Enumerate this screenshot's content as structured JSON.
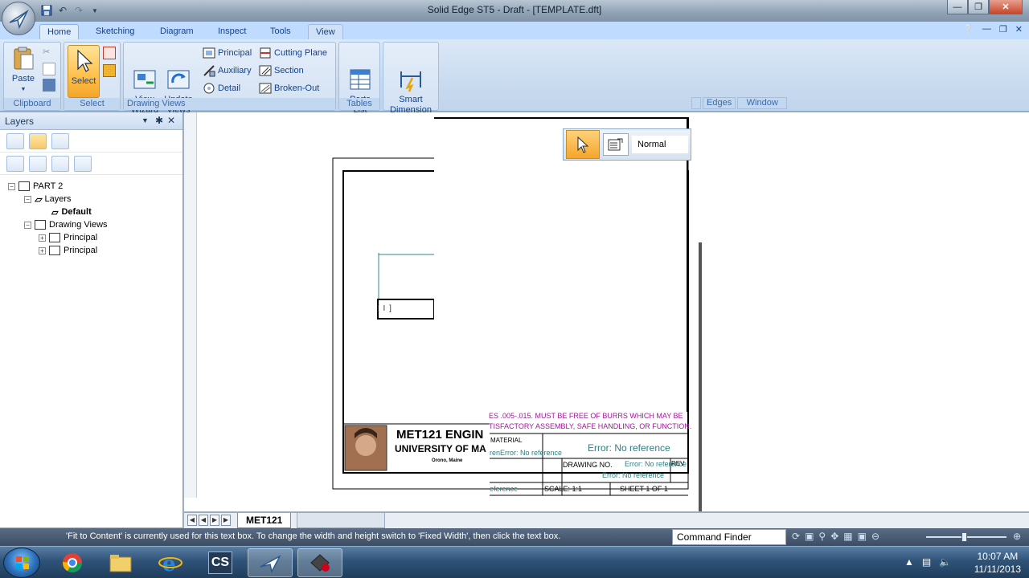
{
  "window": {
    "title": "Solid Edge ST5 - Draft - [TEMPLATE.dft]"
  },
  "ribbon": {
    "tabs": [
      "Home",
      "Sketching",
      "Diagram",
      "Inspect",
      "Tools",
      "View"
    ],
    "active_tab": "Home",
    "groups": {
      "clipboard": {
        "label": "Clipboard",
        "paste": "Paste"
      },
      "select": {
        "label": "Select",
        "select": "Select"
      },
      "drawing_views": {
        "label": "Drawing Views",
        "view_wizard": "View\nWizard",
        "update_views": "Update\nViews",
        "principal": "Principal",
        "auxiliary": "Auxiliary",
        "detail": "Detail",
        "cutting_plane": "Cutting Plane",
        "section": "Section",
        "broken_out": "Broken-Out"
      },
      "tables": {
        "label": "Tables",
        "parts_list": "Parts\nList"
      },
      "dimension": {
        "smart_dimension": "Smart\nDimension"
      }
    },
    "right_items": [
      "Edges",
      "Window"
    ]
  },
  "panel": {
    "title": "Layers",
    "tree": [
      {
        "label": "PART 2",
        "level": 0
      },
      {
        "label": "Layers",
        "level": 1
      },
      {
        "label": "Default",
        "level": 2,
        "bold": true
      },
      {
        "label": "Drawing Views",
        "level": 1
      },
      {
        "label": "Principal",
        "level": 2
      },
      {
        "label": "Principal",
        "level": 2
      }
    ]
  },
  "floating_toolbar": {
    "style_value": "Normal"
  },
  "title_block": {
    "company": "MET121 ENGIN",
    "university": "UNIVERSITY OF MA",
    "city": "Orono, Maine",
    "note_line1": "ES .005-.015. MUST BE FREE OF BURRS WHICH MAY BE",
    "note_line2": "TISFACTORY ASSEMBLY, SAFE HANDLING, OR FUNCTION.",
    "material_label": "MATERIAL",
    "error_main": "Error: No reference",
    "error_short": "renError: No reference",
    "drawing_no_label": "DRAWING NO.",
    "error_drawing": "Error: No reference",
    "rev_label": "REV",
    "error_rev": "Error: No reference",
    "error_bottom": "eference",
    "scale": "SCALE: 1:1",
    "sheet": "SHEET 1 OF 1"
  },
  "sheet_tabs": {
    "active": "MET121"
  },
  "status": {
    "message": "'Fit to Content' is currently used for this text box. To change the width and height switch to 'Fixed Width', then click the text box.",
    "command_finder": "Command Finder"
  },
  "taskbar": {
    "time": "10:07 AM",
    "date": "11/11/2013"
  },
  "colors": {
    "ribbon": "#dbe8f7",
    "accent": "#ffc04a",
    "note": "#a1169a",
    "error": "#2f7f7f"
  }
}
